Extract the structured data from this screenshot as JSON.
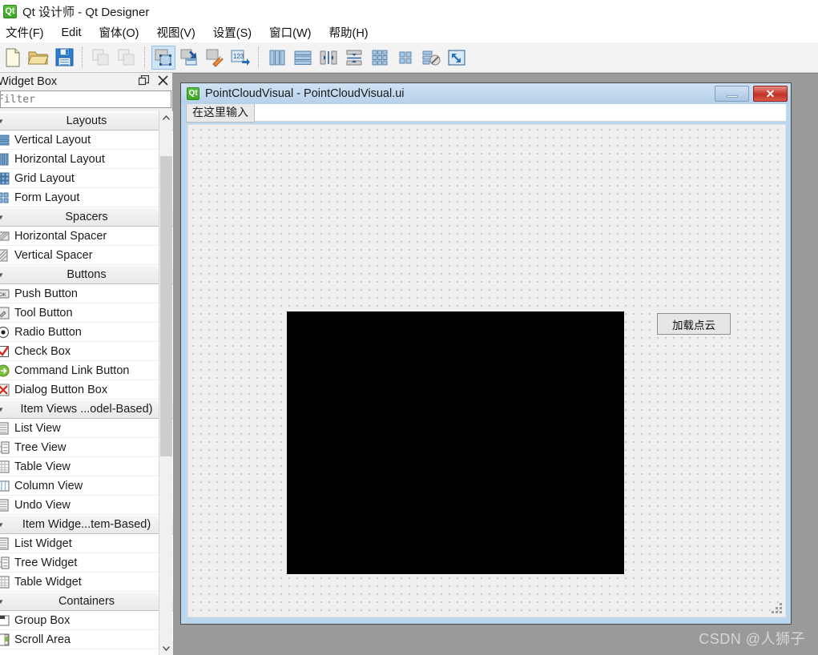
{
  "window": {
    "title": "Qt 设计师 - Qt Designer",
    "icon": "qt-logo-icon",
    "icon_text": "Qt"
  },
  "menubar": {
    "items": [
      {
        "label": "文件(F)",
        "name": "menu-file"
      },
      {
        "label": "Edit",
        "name": "menu-edit"
      },
      {
        "label": "窗体(O)",
        "name": "menu-form"
      },
      {
        "label": "视图(V)",
        "name": "menu-view"
      },
      {
        "label": "设置(S)",
        "name": "menu-settings"
      },
      {
        "label": "窗口(W)",
        "name": "menu-window"
      },
      {
        "label": "帮助(H)",
        "name": "menu-help"
      }
    ]
  },
  "toolbar": {
    "buttons": [
      {
        "name": "new-file-icon",
        "tooltip": "新建",
        "enabled": true,
        "active": false
      },
      {
        "name": "open-folder-icon",
        "tooltip": "打开",
        "enabled": true,
        "active": false
      },
      {
        "name": "save-icon",
        "tooltip": "保存",
        "enabled": true,
        "active": false
      },
      {
        "name": "copy-icon",
        "tooltip": "复制",
        "enabled": false,
        "active": false
      },
      {
        "name": "paste-icon",
        "tooltip": "粘贴",
        "enabled": false,
        "active": false
      },
      {
        "name": "edit-widgets-icon",
        "tooltip": "编辑控件",
        "enabled": true,
        "active": true
      },
      {
        "name": "edit-signals-slots-icon",
        "tooltip": "编辑信号/槽",
        "enabled": true,
        "active": false
      },
      {
        "name": "edit-buddies-icon",
        "tooltip": "编辑伙伴",
        "enabled": true,
        "active": false
      },
      {
        "name": "edit-tab-order-icon",
        "tooltip": "编辑 Tab 顺序",
        "enabled": true,
        "active": false
      },
      {
        "name": "layout-horizontal-icon",
        "tooltip": "水平布局",
        "enabled": true,
        "active": false
      },
      {
        "name": "layout-vertical-icon",
        "tooltip": "垂直布局",
        "enabled": true,
        "active": false
      },
      {
        "name": "layout-splitter-horizontal-icon",
        "tooltip": "水平拆分器布局",
        "enabled": true,
        "active": false
      },
      {
        "name": "layout-splitter-vertical-icon",
        "tooltip": "垂直拆分器布局",
        "enabled": true,
        "active": false
      },
      {
        "name": "layout-grid-icon",
        "tooltip": "栅格布局",
        "enabled": true,
        "active": false
      },
      {
        "name": "layout-form-icon",
        "tooltip": "表单布局",
        "enabled": true,
        "active": false
      },
      {
        "name": "break-layout-icon",
        "tooltip": "打破布局",
        "enabled": true,
        "active": false
      },
      {
        "name": "adjust-size-icon",
        "tooltip": "调整大小",
        "enabled": true,
        "active": false
      }
    ]
  },
  "widget_box": {
    "title": "Widget Box",
    "float_button": "undock-icon",
    "close_button": "close-icon",
    "filter": {
      "value": "",
      "placeholder": "Filter"
    },
    "groups": [
      {
        "category": "Layouts",
        "items": [
          {
            "label": "Vertical Layout",
            "icon": "vertical-layout-icon"
          },
          {
            "label": "Horizontal Layout",
            "icon": "horizontal-layout-icon"
          },
          {
            "label": "Grid Layout",
            "icon": "grid-layout-icon"
          },
          {
            "label": "Form Layout",
            "icon": "form-layout-icon"
          }
        ]
      },
      {
        "category": "Spacers",
        "items": [
          {
            "label": "Horizontal Spacer",
            "icon": "horizontal-spacer-icon"
          },
          {
            "label": "Vertical Spacer",
            "icon": "vertical-spacer-icon"
          }
        ]
      },
      {
        "category": "Buttons",
        "items": [
          {
            "label": "Push Button",
            "icon": "push-button-icon"
          },
          {
            "label": "Tool Button",
            "icon": "tool-button-icon"
          },
          {
            "label": "Radio Button",
            "icon": "radio-button-icon"
          },
          {
            "label": "Check Box",
            "icon": "check-box-icon"
          },
          {
            "label": "Command Link Button",
            "icon": "command-link-button-icon"
          },
          {
            "label": "Dialog Button Box",
            "icon": "dialog-button-box-icon"
          }
        ]
      },
      {
        "category": "Item Views ...odel-Based)",
        "items": [
          {
            "label": "List View",
            "icon": "list-view-icon"
          },
          {
            "label": "Tree View",
            "icon": "tree-view-icon"
          },
          {
            "label": "Table View",
            "icon": "table-view-icon"
          },
          {
            "label": "Column View",
            "icon": "column-view-icon"
          },
          {
            "label": "Undo View",
            "icon": "undo-view-icon"
          }
        ]
      },
      {
        "category": "Item Widge...tem-Based)",
        "items": [
          {
            "label": "List Widget",
            "icon": "list-widget-icon"
          },
          {
            "label": "Tree Widget",
            "icon": "tree-widget-icon"
          },
          {
            "label": "Table Widget",
            "icon": "table-widget-icon"
          }
        ]
      },
      {
        "category": "Containers",
        "items": [
          {
            "label": "Group Box",
            "icon": "group-box-icon"
          },
          {
            "label": "Scroll Area",
            "icon": "scroll-area-icon"
          }
        ]
      }
    ],
    "scroll_up": "▲",
    "scroll_down": "▼"
  },
  "mdi": {
    "form_window": {
      "title": "PointCloudVisual - PointCloudVisual.ui",
      "icon_text": "Qt",
      "minimize_label": "",
      "close_label": "✕",
      "menubar_placeholder": "在这里输入",
      "widgets": [
        {
          "type": "opengl-widget",
          "name": "point-cloud-view",
          "label": ""
        },
        {
          "type": "push-button",
          "name": "load-point-cloud-button",
          "label": "加载点云"
        }
      ]
    }
  },
  "watermark": {
    "text": "CSDN @人狮子"
  },
  "colors": {
    "accent_blue": "#cfe4f7",
    "title_gradient_top": "#cfe2f4",
    "title_gradient_bottom": "#b6d1ea",
    "close_red": "#c23126",
    "canvas_bg": "#efefef",
    "mdi_bg": "#9a9a9a",
    "black_widget": "#000000",
    "qt_green": "#3fa728"
  }
}
